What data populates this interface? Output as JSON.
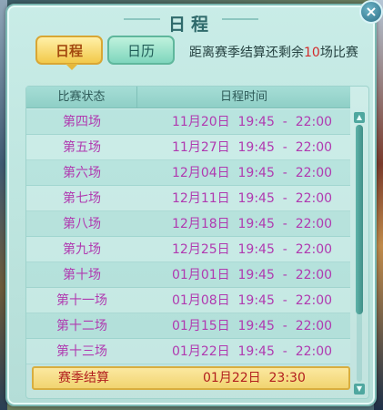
{
  "dialog": {
    "title": "日程",
    "close_glyph": "×"
  },
  "tabs": [
    {
      "label": "日程",
      "active": true
    },
    {
      "label": "日历",
      "active": false
    }
  ],
  "remaining": {
    "prefix": "距离赛季结算还剩余",
    "count": "10",
    "suffix": "场比赛"
  },
  "table": {
    "headers": [
      "比赛状态",
      "日程时间"
    ],
    "rows": [
      {
        "stage": "第四场",
        "time": "11月20日  19:45  -  22:00"
      },
      {
        "stage": "第五场",
        "time": "11月27日  19:45  -  22:00"
      },
      {
        "stage": "第六场",
        "time": "12月04日  19:45  -  22:00"
      },
      {
        "stage": "第七场",
        "time": "12月11日  19:45  -  22:00"
      },
      {
        "stage": "第八场",
        "time": "12月18日  19:45  -  22:00"
      },
      {
        "stage": "第九场",
        "time": "12月25日  19:45  -  22:00"
      },
      {
        "stage": "第十场",
        "time": "01月01日  19:45  -  22:00"
      },
      {
        "stage": "第十一场",
        "time": "01月08日  19:45  -  22:00"
      },
      {
        "stage": "第十二场",
        "time": "01月15日  19:45  -  22:00"
      },
      {
        "stage": "第十三场",
        "time": "01月22日  19:45  -  22:00"
      }
    ],
    "season_end": {
      "stage": "赛季结算",
      "time": "01月22日  23:30"
    }
  },
  "colors": {
    "row_text": "#b03ab0",
    "season_text": "#b21e1e",
    "count_highlight": "#d22b2b",
    "panel_bg": "#c9ece7"
  },
  "icons": {
    "close": "close-icon",
    "scroll_up": "chevron-up-icon",
    "scroll_down": "chevron-down-icon"
  }
}
